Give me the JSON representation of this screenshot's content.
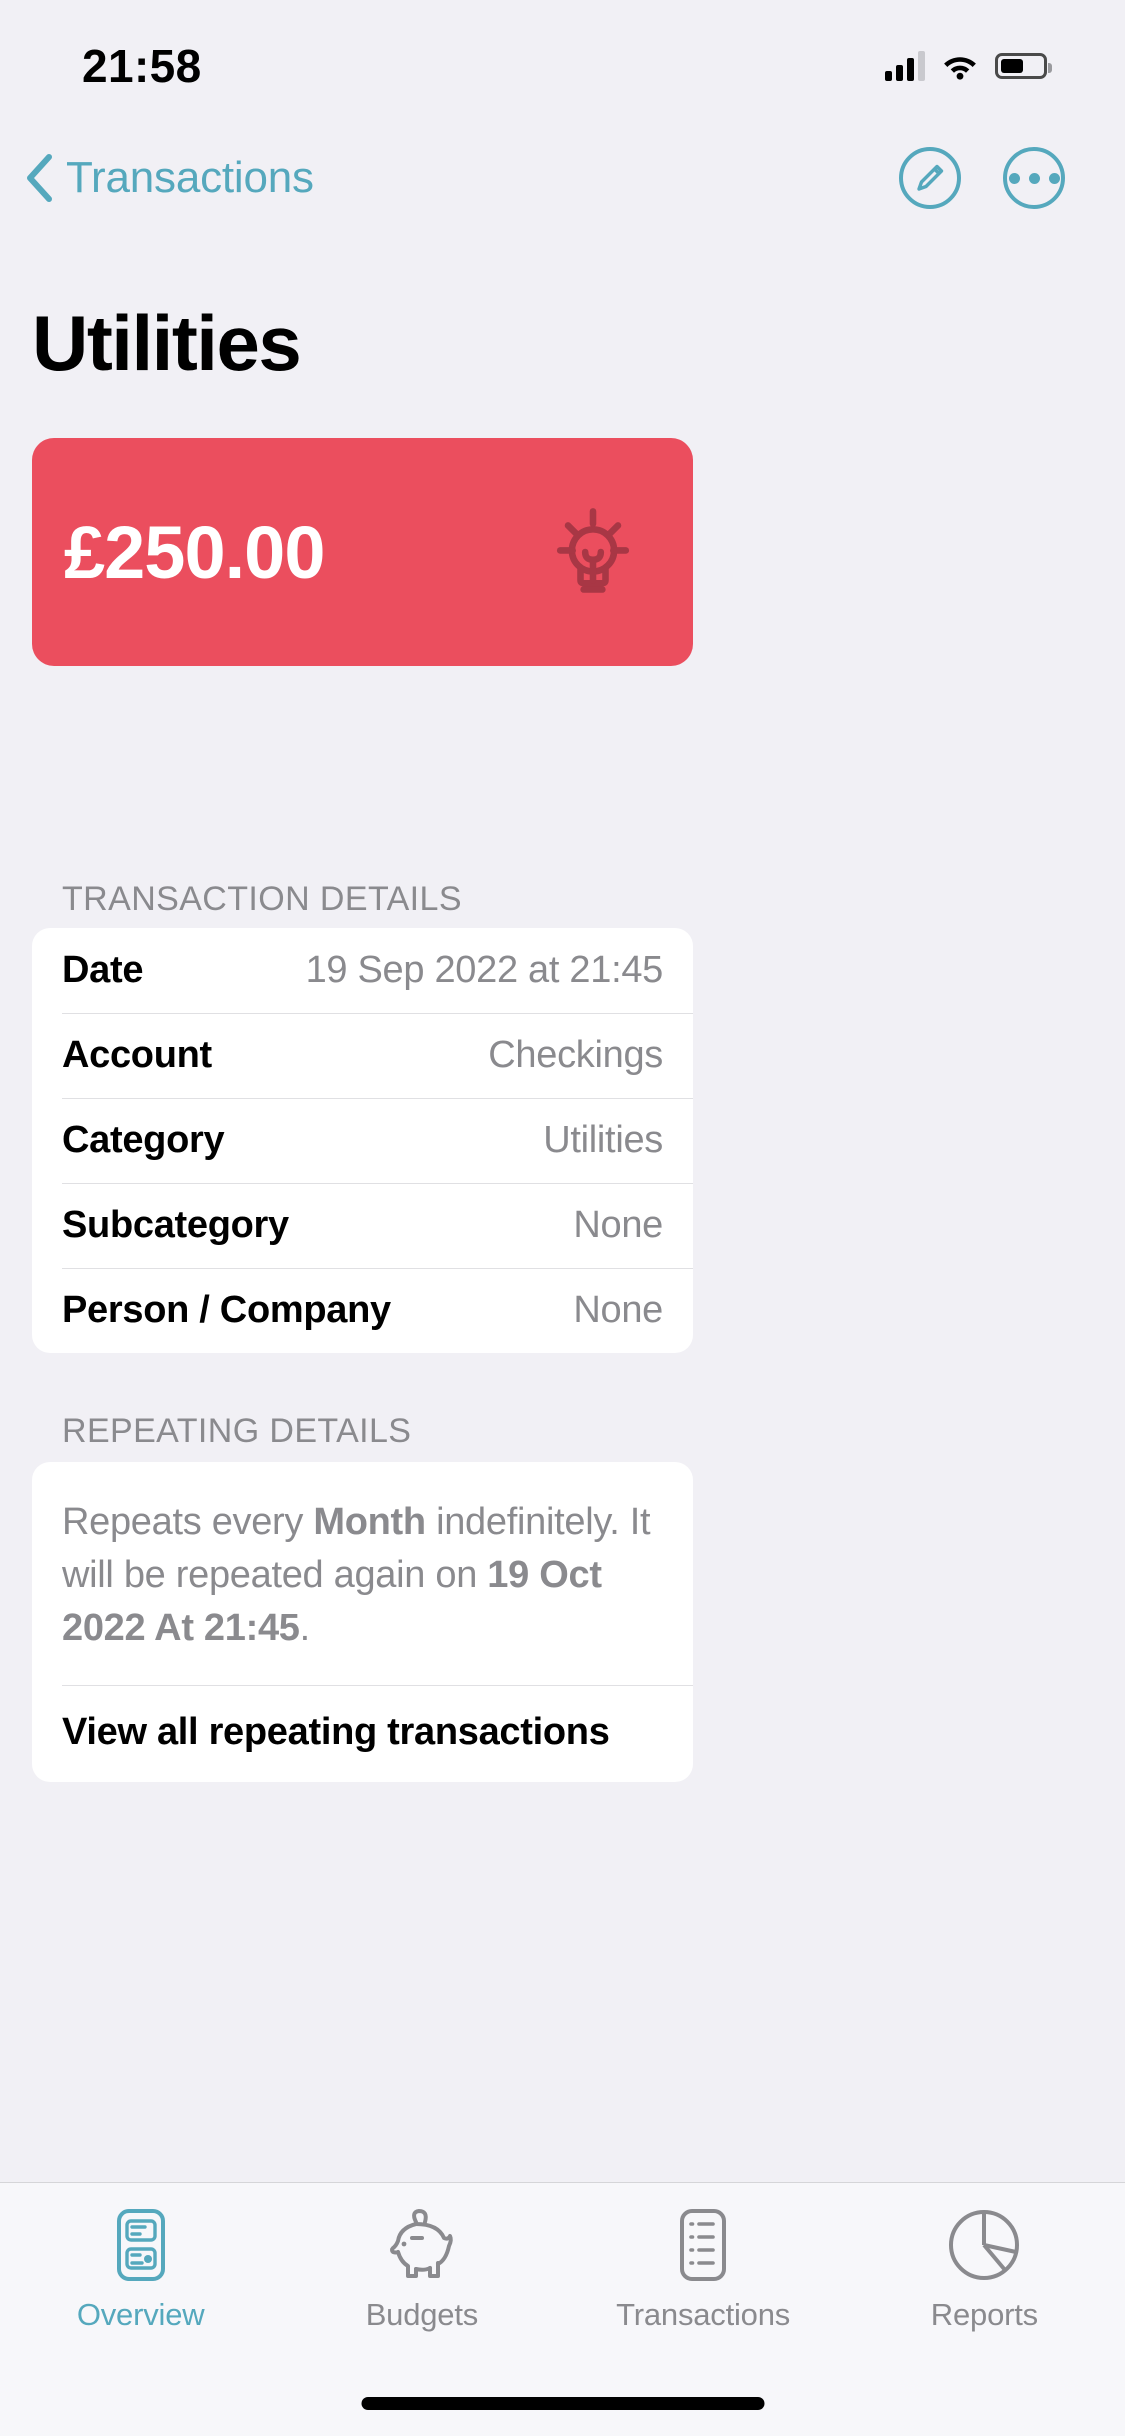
{
  "status_bar": {
    "time": "21:58",
    "cellular_icon": "cellular-signal-icon",
    "wifi_icon": "wifi-icon",
    "battery_icon": "battery-icon",
    "battery_percent": 55
  },
  "nav": {
    "back_label": "Transactions",
    "back_icon": "chevron-left-icon",
    "edit_icon": "pencil-circle-icon",
    "more_icon": "ellipsis-circle-icon",
    "accent_color": "#55A8BD"
  },
  "page": {
    "title": "Utilities"
  },
  "amount_card": {
    "amount": "£250.00",
    "category_icon": "lightbulb-icon",
    "background_color": "#EB4E5E",
    "icon_color": "#A83745"
  },
  "transaction_details": {
    "header": "TRANSACTION DETAILS",
    "rows": [
      {
        "label": "Date",
        "value": "19 Sep 2022 at 21:45"
      },
      {
        "label": "Account",
        "value": "Checkings"
      },
      {
        "label": "Category",
        "value": "Utilities"
      },
      {
        "label": "Subcategory",
        "value": "None"
      },
      {
        "label": "Person / Company",
        "value": "None"
      }
    ]
  },
  "repeating_details": {
    "header": "REPEATING DETAILS",
    "text_part_1": "Repeats every ",
    "text_bold_1": "Month",
    "text_part_2": " indefinitely. It will be repeated again on ",
    "text_bold_2": "19 Oct 2022 At 21:45",
    "text_part_3": ".",
    "link_label": "View all repeating transactions"
  },
  "tabbar": {
    "active_color": "#55A8BD",
    "inactive_color": "#8A8A8E",
    "tabs": [
      {
        "label": "Overview",
        "icon": "overview-icon",
        "active": true
      },
      {
        "label": "Budgets",
        "icon": "piggy-bank-icon",
        "active": false
      },
      {
        "label": "Transactions",
        "icon": "list-icon",
        "active": false
      },
      {
        "label": "Reports",
        "icon": "pie-chart-icon",
        "active": false
      }
    ]
  }
}
